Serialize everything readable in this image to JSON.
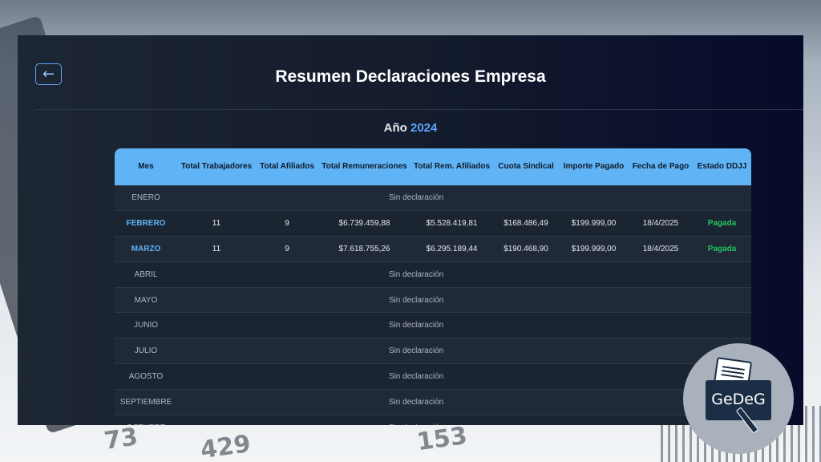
{
  "page": {
    "title": "Resumen Declaraciones Empresa",
    "back_glyph": "←",
    "year_prefix": "Año",
    "year": "2024"
  },
  "table": {
    "headers": [
      "Mes",
      "Total Trabajadores",
      "Total Afiliados",
      "Total Remuneraciones",
      "Total Rem. Afiliados",
      "Cuota Sindical",
      "Importe Pagado",
      "Fecha de Pago",
      "Estado DDJJ"
    ],
    "no_declaration_text": "Sin declaración",
    "rows": [
      {
        "mes": "ENERO",
        "declared": false
      },
      {
        "mes": "FEBRERO",
        "declared": true,
        "trabajadores": "11",
        "afiliados": "9",
        "remuneraciones": "$6.739.459,88",
        "rem_afiliados": "$5.528.419,81",
        "cuota": "$168.486,49",
        "importe": "$199.999,00",
        "fecha": "18/4/2025",
        "estado": "Pagada"
      },
      {
        "mes": "MARZO",
        "declared": true,
        "trabajadores": "11",
        "afiliados": "9",
        "remuneraciones": "$7.618.755,26",
        "rem_afiliados": "$6.295.189,44",
        "cuota": "$190.468,90",
        "importe": "$199.999,00",
        "fecha": "18/4/2025",
        "estado": "Pagada"
      },
      {
        "mes": "ABRIL",
        "declared": false
      },
      {
        "mes": "MAYO",
        "declared": false
      },
      {
        "mes": "JUNIO",
        "declared": false
      },
      {
        "mes": "JULIO",
        "declared": false
      },
      {
        "mes": "AGOSTO",
        "declared": false
      },
      {
        "mes": "SEPTIEMBRE",
        "declared": false
      },
      {
        "mes": "OCTUBRE",
        "declared": false
      }
    ]
  },
  "logo": {
    "text": "GeDeG",
    "icon": "document-pen-logo-icon"
  },
  "colors": {
    "header_bg": "#60b4f5",
    "accent": "#60a5fa",
    "paid": "#22c55e",
    "panel_bg": "#141c2d"
  }
}
